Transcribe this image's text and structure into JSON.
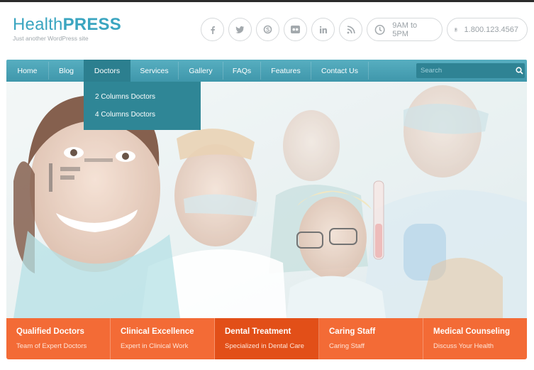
{
  "brand": {
    "name_light": "Health",
    "name_bold": "PRESS",
    "tagline": "Just another WordPress site"
  },
  "social": [
    {
      "name": "facebook-icon",
      "glyph": "f"
    },
    {
      "name": "twitter-icon",
      "glyph": "t"
    },
    {
      "name": "skype-icon",
      "glyph": "S"
    },
    {
      "name": "flickr-icon",
      "glyph": "●●"
    },
    {
      "name": "linkedin-icon",
      "glyph": "in"
    },
    {
      "name": "rss-icon",
      "glyph": "rss"
    }
  ],
  "hours": "9AM to 5PM",
  "phone": "1.800.123.4567",
  "nav": {
    "items": [
      "Home",
      "Blog",
      "Doctors",
      "Services",
      "Gallery",
      "FAQs",
      "Features",
      "Contact Us"
    ],
    "active": "Doctors",
    "search_placeholder": "Search"
  },
  "dropdown": [
    "2 Columns Doctors",
    "4 Columns Doctors"
  ],
  "features": [
    {
      "title": "Qualified Doctors",
      "subtitle": "Team of Expert Doctors"
    },
    {
      "title": "Clinical Excellence",
      "subtitle": "Expert in Clinical Work"
    },
    {
      "title": "Dental Treatment",
      "subtitle": "Specialized in Dental Care"
    },
    {
      "title": "Caring Staff",
      "subtitle": "Caring Staff"
    },
    {
      "title": "Medical Counseling",
      "subtitle": "Discuss Your Health"
    }
  ],
  "colors": {
    "brand": "#3aa5c0",
    "nav": "#4aa3b6",
    "nav_active": "#2c7f8f",
    "feature": "#f36b36",
    "feature_active": "#e24f18"
  }
}
